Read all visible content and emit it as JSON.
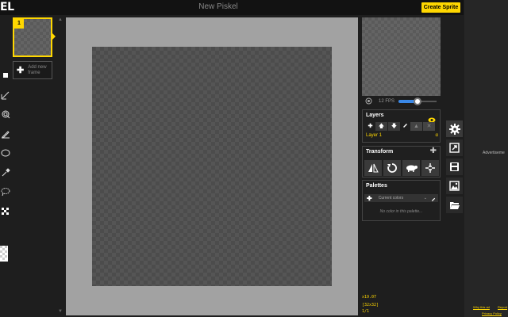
{
  "app": {
    "logo": "EL",
    "title": "New Piskel",
    "create_label": "Create Sprite"
  },
  "tools": [
    "pen-icon",
    "vertical-mirror-pen-icon",
    "paint-bucket-icon",
    "stroke-icon",
    "circle-icon",
    "color-picker-icon",
    "lasso-select-icon",
    "dither-icon"
  ],
  "frames": {
    "items": [
      {
        "number": "1"
      }
    ],
    "add_label": "Add new frame"
  },
  "preview": {
    "fps_label": "12 FPS",
    "fps": 12,
    "fps_max": 24
  },
  "layers": {
    "title": "Layers",
    "layer_name": "Layer 1",
    "alpha": "α"
  },
  "transform": {
    "title": "Transform"
  },
  "palettes": {
    "title": "Palettes",
    "selected": "Current colors",
    "empty_text": "No color in this palette..."
  },
  "status": {
    "coords": "x19.07",
    "size": "[32x32]",
    "frame": "1/1"
  },
  "ad": {
    "label": "Advertiseme",
    "why": "Why this ad",
    "report": "Report",
    "privacy": "Privacy Policy"
  },
  "colors": {
    "accent": "#ffd700",
    "slider": "#3a88e6",
    "canvas_bg": "#a2a2a2",
    "app_bg": "#1e1e1e"
  }
}
